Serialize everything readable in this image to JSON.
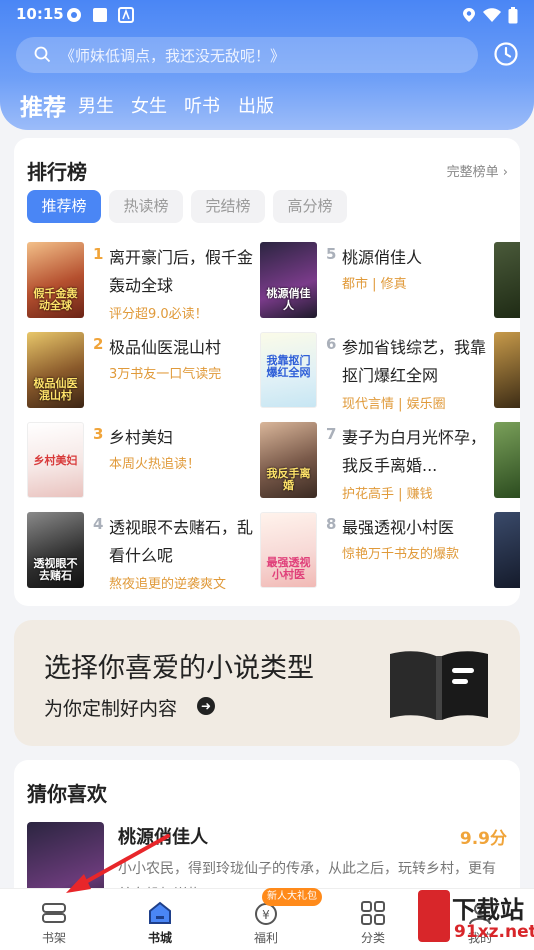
{
  "status_bar": {
    "time": "10:15"
  },
  "header": {
    "search_placeholder": "《师妹低调点，我还没无敌呢！》",
    "categories": [
      {
        "label": "推荐",
        "active": true
      },
      {
        "label": "男生"
      },
      {
        "label": "女生"
      },
      {
        "label": "听书"
      },
      {
        "label": "出版"
      }
    ]
  },
  "ranking": {
    "title": "排行榜",
    "more_label": "完整榜单",
    "tabs": [
      {
        "label": "推荐榜",
        "active": true
      },
      {
        "label": "热读榜"
      },
      {
        "label": "完结榜"
      },
      {
        "label": "高分榜"
      }
    ],
    "books": [
      {
        "rank": "1",
        "title": "离开豪门后，假千金轰动全球",
        "sub": "评分超9.0必读！",
        "cover_text": "假千金轰动全球"
      },
      {
        "rank": "2",
        "title": "极品仙医混山村",
        "sub": "3万书友一口气读完",
        "cover_text": "极品仙医混山村"
      },
      {
        "rank": "3",
        "title": "乡村美妇",
        "sub": "本周火热追读！",
        "cover_text": "乡村美妇"
      },
      {
        "rank": "4",
        "title": "透视眼不去赌石，乱看什么呢",
        "sub": "熬夜追更的逆袭爽文",
        "cover_text": "透视眼不去赌石"
      },
      {
        "rank": "5",
        "title": "桃源俏佳人",
        "sub": "都市 | 修真",
        "cover_text": "桃源俏佳人"
      },
      {
        "rank": "6",
        "title": "参加省钱综艺，我靠抠门爆红全网",
        "sub": "现代言情 | 娱乐圈",
        "cover_text": "我靠抠门爆红全网"
      },
      {
        "rank": "7",
        "title": "妻子为白月光怀孕，我反手离婚...",
        "sub": "护花高手 | 赚钱",
        "cover_text": "我反手离婚"
      },
      {
        "rank": "8",
        "title": "最强透视小村医",
        "sub": "惊艳万千书友的爆款",
        "cover_text": "最强透视小村医"
      }
    ]
  },
  "promo": {
    "title": "选择你喜爱的小说类型",
    "subtitle": "为你定制好内容"
  },
  "guess": {
    "title": "猜你喜欢",
    "book_title": "桃源俏佳人",
    "score": "9.9分",
    "description": "小小农民，得到玲珑仙子的传承，从此之后，玩转乡村，更有美女投怀送抱……"
  },
  "tabbar": {
    "items": [
      {
        "label": "书架",
        "icon": "bookshelf-icon"
      },
      {
        "label": "书城",
        "icon": "bookstore-icon",
        "active": true
      },
      {
        "label": "福利",
        "icon": "welfare-icon"
      },
      {
        "label": "分类",
        "icon": "category-icon"
      },
      {
        "label": "我的",
        "icon": "profile-icon"
      }
    ],
    "badge": "新人大礼包"
  },
  "watermark": {
    "line1": "下载站",
    "line2": "91xz.net"
  },
  "colors": {
    "accent": "#4a86f5",
    "hot": "#f0a43a",
    "sub": "#e09a3a"
  }
}
